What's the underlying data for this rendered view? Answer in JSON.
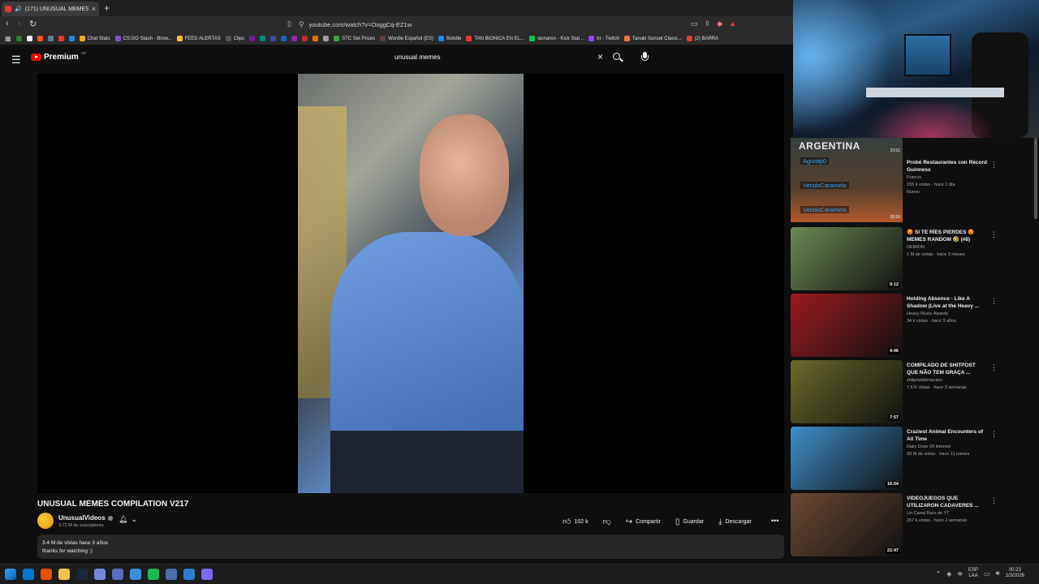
{
  "browser": {
    "tab_title": "(171) UNUSUAL MEMES COM",
    "url": "youtube.com/watch?v=OoggCq-EZ1w",
    "bookmarks": [
      {
        "label": "",
        "color": "#2e7d32"
      },
      {
        "label": "",
        "color": "#ffffff"
      },
      {
        "label": "",
        "color": "#ff5722"
      },
      {
        "label": "",
        "color": "#607d8b"
      },
      {
        "label": "",
        "color": "#e53935"
      },
      {
        "label": "",
        "color": "#1e88e5"
      },
      {
        "label": "Chat Stats",
        "color": "#f9a825"
      },
      {
        "label": "CS:GO Stash - Brow...",
        "color": "#7e57c2"
      },
      {
        "label": "FEED ALERTAS",
        "color": "#fbc02d"
      },
      {
        "label": "Clips",
        "color": "#555555"
      },
      {
        "label": "",
        "color": "#6a1b9a"
      },
      {
        "label": "",
        "color": "#00897b"
      },
      {
        "label": "",
        "color": "#3949ab"
      },
      {
        "label": "",
        "color": "#1565c0"
      },
      {
        "label": "",
        "color": "#8e24aa"
      },
      {
        "label": "",
        "color": "#c62828"
      },
      {
        "label": "",
        "color": "#ef6c00"
      },
      {
        "label": "",
        "color": "#9e9e9e"
      },
      {
        "label": "STC Set Prices",
        "color": "#43a047"
      },
      {
        "label": "Wordle Español (ES)",
        "color": "#5d4037"
      },
      {
        "label": "Bokdle",
        "color": "#1e88e5"
      },
      {
        "label": "TAN BIONICA EN EL...",
        "color": "#e53935"
      },
      {
        "label": "sionaron - Kick Stat...",
        "color": "#00c853"
      },
      {
        "label": "trr - Twitch",
        "color": "#9146ff"
      },
      {
        "label": "Tanuki Sunset Classi...",
        "color": "#ff7043"
      },
      {
        "label": "(2) BARRA",
        "color": "#e53935"
      }
    ]
  },
  "youtube": {
    "logo_text": "Premium",
    "country_code": "AR",
    "search_value": "unusual memes",
    "video_title": "UNUSUAL MEMES COMPILATION V217",
    "channel_name": "UnusualVideos",
    "subscribers": "3.72 M de suscriptores",
    "likes": "102 k",
    "share_label": "Compartir",
    "save_label": "Guardar",
    "download_label": "Descargar",
    "views_date": "3.4 M de vistas  hace 3 años",
    "description": "thanks for watching :)"
  },
  "stream_overlay": {
    "banner": "ARGENTINA",
    "duration1": "23:51",
    "duration2": "20:39",
    "chat": [
      "Agustip0",
      "VendoCaramelo",
      "VendoCaramelo"
    ]
  },
  "recommendations": [
    {
      "title": "Probé Restaurantes con Récord Guinness",
      "channel": "Francis",
      "meta": "155 k vistas · hace 1 día",
      "extra": "Nuevo",
      "duration": "",
      "thumb": "#3a3230"
    },
    {
      "title": "😡 SI TE RÍES PIERDES 😡 MEMES RANDOM 🤣 (#8)",
      "channel": "DEIMON",
      "meta": "1 M de vistas · hace 3 meses",
      "extra": "",
      "duration": "9:12",
      "thumb": "#6d8a55"
    },
    {
      "title": "Holding Absence - Like A Shadow (Live at the Heavy ...",
      "channel": "Heavy Music Awards",
      "meta": "34 k vistas · hace 3 años",
      "extra": "",
      "duration": "4:46",
      "thumb": "#9c1a22"
    },
    {
      "title": "COMPILADO DE SHITPOST QUE NÃO TEM GRAÇA ...",
      "channel": "shitpostdomacaco",
      "meta": "7.6 K vistas · hace 3 semanas",
      "extra": "",
      "duration": "7:57",
      "thumb": "#6a6a2a"
    },
    {
      "title": "Craziest Animal Encounters of All Time",
      "channel": "Daily Dose Of Internet",
      "meta": "33 M de vistas · hace 11 meses",
      "extra": "",
      "duration": "16:04",
      "thumb": "#3d8fc9"
    },
    {
      "title": "VIDEOJUEGOS QUE UTILIZARON CADAVERES ...",
      "channel": "Un Canal Raro de YT",
      "meta": "257 k vistas · hace 2 semanas",
      "extra": "",
      "duration": "22:47",
      "thumb": "#6b4a35"
    }
  ],
  "taskbar": {
    "apps": [
      "#0078d4",
      "#e65100",
      "#f2c14e",
      "#1b2838",
      "#7289da",
      "#5c6bc0",
      "#3c8dde",
      "#1db954",
      "#4a6fa5",
      "#2f7dd1",
      "#7b68ee"
    ],
    "lang": "ESP",
    "region": "LAA",
    "time": "00:23",
    "date": "1/3/2026"
  }
}
